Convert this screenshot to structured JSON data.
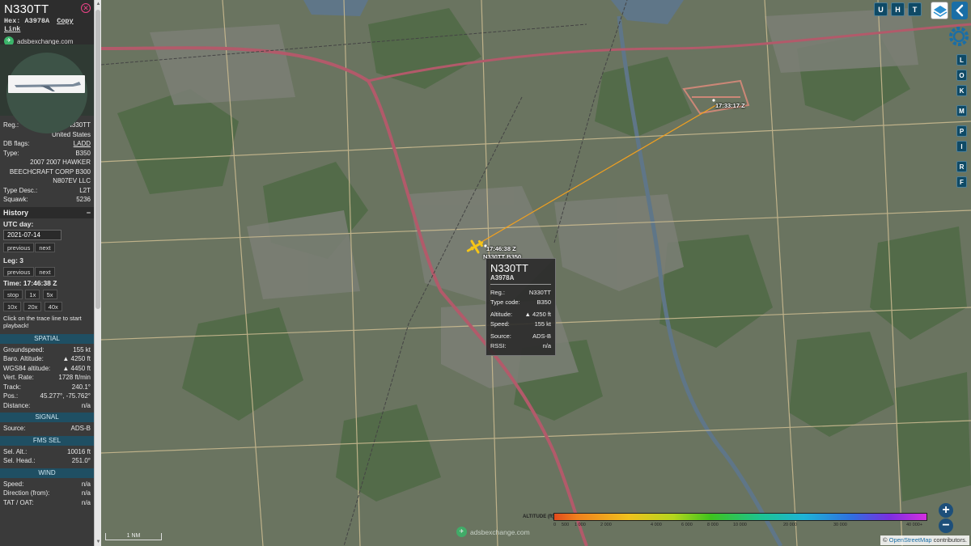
{
  "aircraft": {
    "callsign": "N330TT",
    "hex_label": "Hex:",
    "hex": "A3978A",
    "copy_link": "Copy Link",
    "site_link": "adsbexchange.com"
  },
  "details": [
    {
      "k": "Reg.:",
      "v": "N330TT"
    },
    {
      "k": "",
      "v": "United States"
    },
    {
      "k": "DB flags:",
      "v": "LADD"
    },
    {
      "k": "Type:",
      "v": "B350"
    },
    {
      "k": "",
      "v": "2007 2007 HAWKER"
    },
    {
      "k": "",
      "v": "BEECHCRAFT CORP B300"
    },
    {
      "k": "",
      "v": "N807EV LLC"
    },
    {
      "k": "Type Desc.:",
      "v": "L2T"
    },
    {
      "k": "Squawk:",
      "v": "5236"
    }
  ],
  "history": {
    "title": "History",
    "collapse": "−",
    "utc_day_label": "UTC day:",
    "date": "2021-07-14",
    "previous": "previous",
    "next": "next",
    "leg_label": "Leg: 3",
    "time_label": "Time: 17:46:38 Z",
    "stop": "stop",
    "speeds": [
      "1x",
      "5x",
      "10x",
      "20x",
      "40x"
    ],
    "note": "Click on the trace line to start playback!"
  },
  "spatial": {
    "title": "SPATIAL",
    "rows": [
      {
        "k": "Groundspeed:",
        "v": "155 kt"
      },
      {
        "k": "Baro. Altitude:",
        "v": "▲ 4250 ft"
      },
      {
        "k": "WGS84 altitude:",
        "v": "▲ 4450 ft"
      },
      {
        "k": "Vert. Rate:",
        "v": "1728 ft/min"
      },
      {
        "k": "Track:",
        "v": "240.1°"
      },
      {
        "k": "Pos.:",
        "v": "45.277°, -75.762°"
      },
      {
        "k": "Distance:",
        "v": "n/a"
      }
    ]
  },
  "signal": {
    "title": "SIGNAL",
    "rows": [
      {
        "k": "Source:",
        "v": "ADS-B"
      }
    ]
  },
  "fms": {
    "title": "FMS SEL",
    "rows": [
      {
        "k": "Sel. Alt.:",
        "v": "10016 ft"
      },
      {
        "k": "Sel. Head.:",
        "v": "251.0°"
      }
    ]
  },
  "wind": {
    "title": "WIND",
    "rows": [
      {
        "k": "Speed:",
        "v": "n/a"
      },
      {
        "k": "Direction (from):",
        "v": "n/a"
      },
      {
        "k": "TAT / OAT:",
        "v": "n/a"
      }
    ]
  },
  "popup": {
    "callsign": "N330TT",
    "hex": "A3978A",
    "rows1": [
      {
        "k": "Reg.:",
        "v": "N330TT"
      },
      {
        "k": "Type code:",
        "v": "B350"
      }
    ],
    "rows2": [
      {
        "k": "Altitude:",
        "v": "▲ 4250 ft"
      },
      {
        "k": "Speed:",
        "v": "155 kt"
      }
    ],
    "rows3": [
      {
        "k": "Source:",
        "v": "ADS-B"
      },
      {
        "k": "RSSI:",
        "v": "n/a"
      }
    ]
  },
  "map": {
    "time_label_1": "17:33:17 Z",
    "time_label_2": "17:46:38 Z",
    "plane_label": "N330TT B350",
    "scale": "1 NM",
    "brand": "adsbexchange.com",
    "attribution_symbol": "©",
    "attribution_link": "OpenStreetMap",
    "attribution_rest": " contributors.",
    "altitude_legend": "ALTITUDE (ft)",
    "altitude_ticks": [
      "0",
      "500",
      "1 000",
      "2 000",
      "4 000",
      "6 000",
      "8 000",
      "10 000",
      "20 000",
      "30 000",
      "40 000+"
    ],
    "zoom_in": "+",
    "zoom_out": "−"
  },
  "controls": {
    "top": [
      "U",
      "H",
      "T"
    ],
    "side": [
      "L",
      "O",
      "K",
      "M",
      "P",
      "I",
      "R",
      "F"
    ]
  },
  "colors": {
    "trail": "#f0a020",
    "panel": "#3a3a3a",
    "section": "#1f4f63",
    "button": "#0f4a66"
  }
}
